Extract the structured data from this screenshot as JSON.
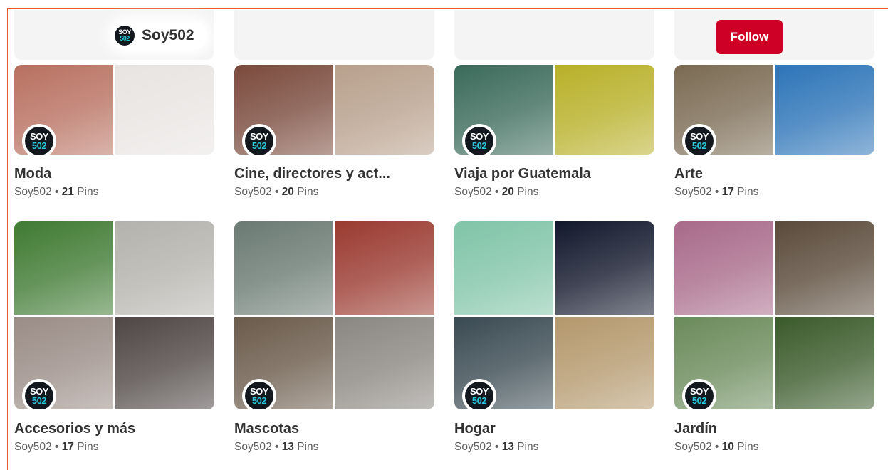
{
  "profile": {
    "name": "Soy502",
    "logo_text_top": "SOY",
    "logo_text_bottom": "502"
  },
  "header": {
    "follow_label": "Follow"
  },
  "labels": {
    "separator": "•",
    "pins_word": "Pins"
  },
  "boards": [
    {
      "title": "Moda",
      "owner": "Soy502",
      "pins": "21",
      "tiles": [
        "#b87060",
        "#e8e4e2"
      ]
    },
    {
      "title": "Cine, directores y act...",
      "owner": "Soy502",
      "pins": "20",
      "tiles": [
        "#7a4a3c",
        "#b8a08c"
      ]
    },
    {
      "title": "Viaja por Guatemala",
      "owner": "Soy502",
      "pins": "20",
      "tiles": [
        "#3a6a5a",
        "#b8b028"
      ]
    },
    {
      "title": "Arte",
      "owner": "Soy502",
      "pins": "17",
      "tiles": [
        "#7a6a52",
        "#2c74b8"
      ]
    },
    {
      "title": "Accesorios y más",
      "owner": "Soy502",
      "pins": "17",
      "tiles": [
        "#3f7a32",
        "#b4b2ac",
        "#9a8c86",
        "#4e4644"
      ]
    },
    {
      "title": "Mascotas",
      "owner": "Soy502",
      "pins": "13",
      "tiles": [
        "#6a7a72",
        "#9a3a30",
        "#6a5a4a",
        "#8a8680"
      ]
    },
    {
      "title": "Hogar",
      "owner": "Soy502",
      "pins": "13",
      "tiles": [
        "#80c4a8",
        "#12182c",
        "#3a4a52",
        "#b4986c"
      ]
    },
    {
      "title": "Jardín",
      "owner": "Soy502",
      "pins": "10",
      "tiles": [
        "#a86a8a",
        "#5a4a3a",
        "#6a8a5a",
        "#3a5a2a"
      ]
    }
  ],
  "colors": {
    "accent": "#cf0025",
    "frame": "#e7592a",
    "logo_bg": "#12181d",
    "logo_accent": "#29c6dc"
  }
}
